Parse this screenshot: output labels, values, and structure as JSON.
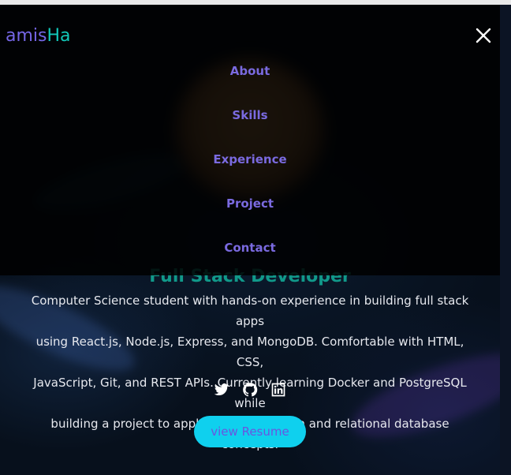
{
  "header": {
    "logo_part1": "amis",
    "logo_part2": "Ha",
    "close_icon": "close-x-icon"
  },
  "menu": {
    "items": [
      {
        "label": "About"
      },
      {
        "label": "Skills"
      },
      {
        "label": "Experience"
      },
      {
        "label": "Project"
      },
      {
        "label": "Contact"
      }
    ]
  },
  "hero": {
    "role": "Full Stack Developer",
    "bio_lines": [
      "Computer Science student with hands-on experience in building full stack apps",
      "using React.js, Node.js, Express, and MongoDB. Comfortable with HTML, CSS,",
      "JavaScript, Git, and REST APIs. Currently learning Docker and PostgreSQL while",
      "building a project to apply containerization and relational database concepts."
    ],
    "socials": [
      {
        "icon": "twitter-icon"
      },
      {
        "icon": "github-icon"
      },
      {
        "icon": "linkedin-icon"
      }
    ],
    "resume_label": "view Resume"
  },
  "colors": {
    "menu_link": "#7a6ae0",
    "logo_primary": "#7566e6",
    "logo_accent": "#12c8b9",
    "role_text": "#11998a",
    "resume_bg": "#0fd0ee",
    "resume_text": "#6a55e0"
  }
}
